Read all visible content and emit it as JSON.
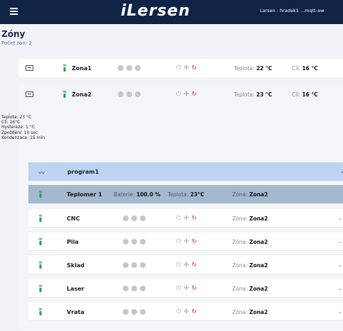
{
  "header": {
    "logo": "iLersen",
    "user_info": "Larsen : hradek1 ...mqtt-aw"
  },
  "page": {
    "title": "Zóny",
    "subtitle": "Počet zón: 2"
  },
  "zones": [
    {
      "name": "Zona1",
      "temp_label": "Teplota: ",
      "temp": "22 °C",
      "target_label": "Cíl: ",
      "target": "16 °C"
    },
    {
      "name": "Zona2",
      "temp_label": "Teplota: ",
      "temp": "23 °C",
      "target_label": "Cíl: ",
      "target": "16 °C"
    }
  ],
  "zone2_details": {
    "teplota": "Teplota: 23 °C",
    "cil": "Cíl: 16°C",
    "hystereze": "Hystereze: 1 °C",
    "zpozdeni": "Zpoždění: 10 sec",
    "kondenzace": "Kondenzace: 15 min"
  },
  "program": {
    "name": "program1"
  },
  "teplomer": {
    "name": "Teplomer 1",
    "battery_label": "Baterie: ",
    "battery": "100.0 %",
    "temp_label": "Teplota: ",
    "temp": "23°C",
    "zone_label": "Zóna: ",
    "zone": "Zona2"
  },
  "devices": [
    {
      "name": "CNC",
      "zone_label": "Zóna: ",
      "zone": "Zona2"
    },
    {
      "name": "Pila",
      "zone_label": "Zóna: ",
      "zone": "Zona2"
    },
    {
      "name": "Sklad",
      "zone_label": "Zóna: ",
      "zone": "Zona2"
    },
    {
      "name": "Laser",
      "zone_label": "Zóna: ",
      "zone": "Zona2"
    },
    {
      "name": "Vrata",
      "zone_label": "Zóna: ",
      "zone": "Zona2"
    }
  ],
  "icons": {
    "menu": "menu-icon",
    "dimension": "dimension-icon",
    "sensor": "sensor-icon",
    "power": "power-icon",
    "fan": "fan-icon",
    "refresh": "refresh-icon",
    "trend": "trend-icon",
    "chevron": "chevron-down-icon"
  },
  "colors": {
    "header_bg": "#0f2446",
    "program_bg": "#bcd3f2",
    "teplomer_bg": "#a4b8d0",
    "sensor_green": "#1fa34a",
    "refresh_pink": "#f0466f"
  }
}
